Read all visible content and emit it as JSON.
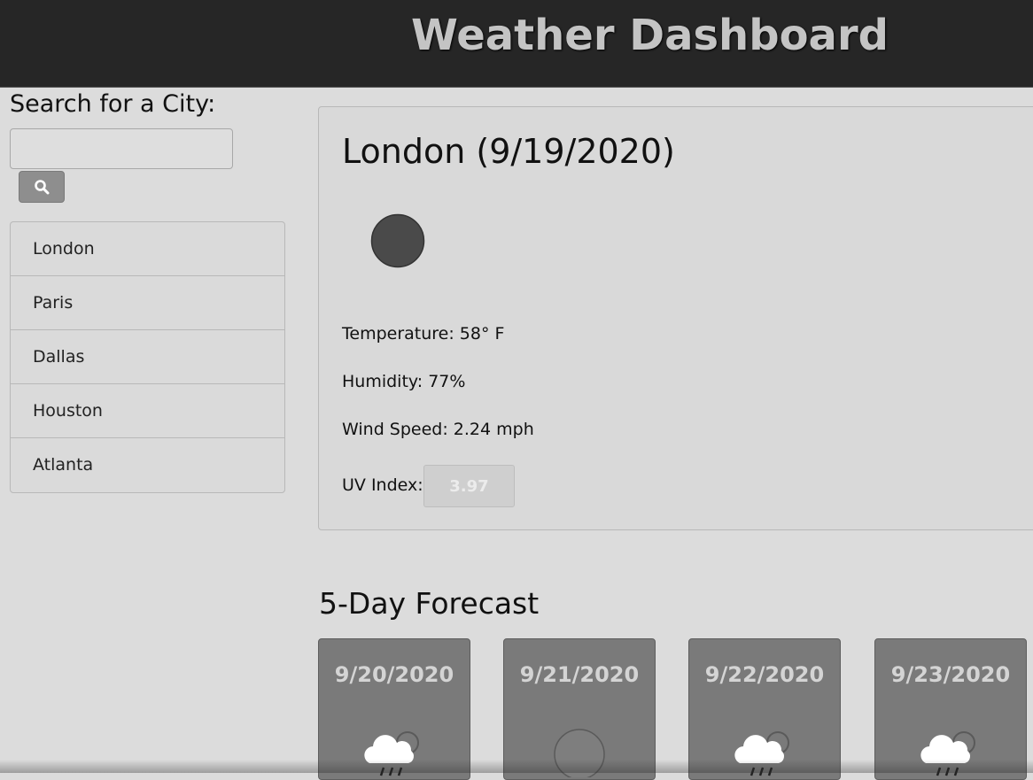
{
  "header": {
    "title": "Weather Dashboard"
  },
  "sidebar": {
    "search_label": "Search for a City:",
    "search_placeholder": "",
    "search_value": "",
    "search_button_icon": "search-icon",
    "cities": [
      {
        "label": "London"
      },
      {
        "label": "Paris"
      },
      {
        "label": "Dallas"
      },
      {
        "label": "Houston"
      },
      {
        "label": "Atlanta"
      }
    ]
  },
  "current": {
    "title": "London (9/19/2020)",
    "icon": "clear-night-icon",
    "temperature": "Temperature: 58° F",
    "humidity": "Humidity: 77%",
    "wind": "Wind Speed: 2.24 mph",
    "uv_label": "UV Index:",
    "uv_value": "3.97"
  },
  "forecast": {
    "heading": "5-Day Forecast",
    "days": [
      {
        "date": "9/20/2020",
        "icon": "rain-cloud-icon"
      },
      {
        "date": "9/21/2020",
        "icon": "clear-night-icon"
      },
      {
        "date": "9/22/2020",
        "icon": "rain-cloud-icon"
      },
      {
        "date": "9/23/2020",
        "icon": "rain-cloud-icon"
      }
    ]
  },
  "colors": {
    "header_bg": "#262626",
    "forecast_card_bg": "#7a7a7a",
    "search_button_bg": "#8e8e8e"
  }
}
